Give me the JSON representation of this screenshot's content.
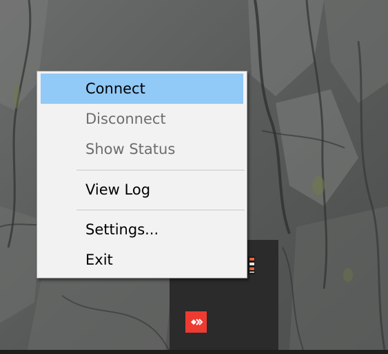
{
  "colors": {
    "menu_background": "#f2f2f2",
    "menu_highlight": "#91c9f7",
    "menu_text": "#000000",
    "menu_text_disabled": "#6d6d6d",
    "tray_background": "#2b2b2b",
    "tray_app_icon": "#ee3b32"
  },
  "context_menu": {
    "items": [
      {
        "label": "Connect",
        "state": "highlighted"
      },
      {
        "label": "Disconnect",
        "state": "disabled"
      },
      {
        "label": "Show Status",
        "state": "disabled"
      },
      {
        "label": "View Log",
        "state": "enabled"
      },
      {
        "label": "Settings...",
        "state": "enabled"
      },
      {
        "label": "Exit",
        "state": "enabled"
      }
    ]
  },
  "tray": {
    "app_icon": "red-diamond-arrows-icon",
    "partial_icon": "partial-tray-icon"
  }
}
